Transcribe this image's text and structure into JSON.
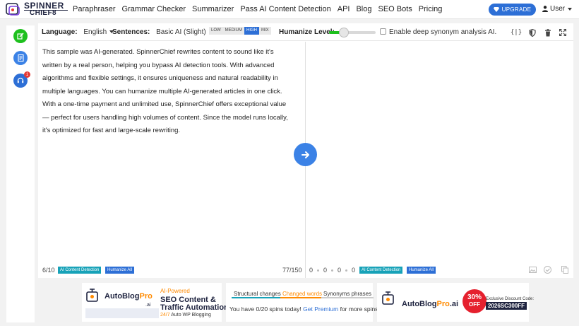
{
  "brand": {
    "line1": "SPINNER",
    "line2": "CHIEF8"
  },
  "nav": {
    "links": [
      "Paraphraser",
      "Grammar Checker",
      "Summarizer",
      "Pass AI Content Detection",
      "API",
      "Blog",
      "SEO Bots",
      "Pricing"
    ],
    "upgrade_label": "UPGRADE",
    "user_label": "User"
  },
  "sidebar": {
    "badge_count": "1"
  },
  "toolbar": {
    "language_label": "Language:",
    "language_value": "English",
    "sentences_label": "Sentences:",
    "sentences_value": "Basic AI (Slight)",
    "levels": [
      "LOW",
      "MEDIUM",
      "HIGH",
      "MIX"
    ],
    "active_level": "HIGH",
    "humanize_label": "Humanize Level:",
    "humanize_level_fraction": 0.3,
    "deep_synonym_label": "Enable deep synonym analysis AI.",
    "deep_synonym_checked": false
  },
  "editor": {
    "input_text": "This sample was AI-generated. SpinnerChief rewrites content to sound like it's written by a real person, helping you bypass AI detection tools. With advanced algorithms and flexible settings, it ensures uniqueness and natural readability in multiple languages. You can humanize multiple AI-generated articles in one click. With a one-time payment and unlimited use, SpinnerChief offers exceptional value— perfect for users handling high volumes of content. Since the model runs locally, it's optimized for fast and large-scale rewriting.",
    "page_count": "6/10",
    "ai_detection_label": "AI Content Detection",
    "humanize_all_label": "Humanize All",
    "word_counter": "77/150"
  },
  "output": {
    "stats": [
      "0",
      "0",
      "0",
      "0"
    ],
    "ai_detection_label": "AI Content Detection",
    "humanize_all_label": "Humanize All"
  },
  "ads": {
    "left": {
      "logo_main": "AutoBlog",
      "logo_accent": "Pro",
      "logo_suffix": ".ai",
      "tagline_small": "AI-Powered",
      "headline1": "SEO Content &",
      "headline2": "Traffic Automation",
      "sub_accent": "24/7",
      "sub_rest": " Auto WP Blogging"
    },
    "mid": {
      "tabs": [
        "Structural changes",
        "Changed words",
        "Synonyms phrases"
      ],
      "spins_text": "You have 0/20 spins today!",
      "premium_link": "Get Premium",
      "spins_suffix": " for more spins."
    },
    "right": {
      "logo_main": "AutoBlog",
      "logo_accent": "Pro",
      "logo_suffix": ".ai",
      "discount_pct": "30%",
      "discount_off": "OFF",
      "code_label": "Exclusive Discount Code:",
      "code_value": "2026SC300FF"
    }
  },
  "colors": {
    "accent": "#2d6fd6",
    "teal": "#17a2b8",
    "green": "#1ec01e",
    "orange": "#ff8a00"
  }
}
